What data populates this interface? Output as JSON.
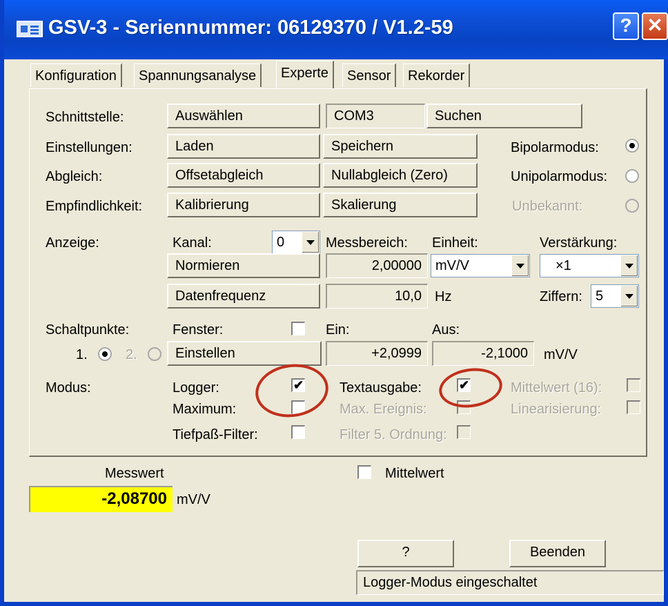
{
  "window": {
    "title": "GSV-3 - Seriennummer: 06129370 / V1.2-59",
    "help_label": "?",
    "close_label": "✕"
  },
  "tabs": [
    {
      "label": "Konfiguration",
      "active": false
    },
    {
      "label": "Spannungsanalyse",
      "active": false
    },
    {
      "label": "Experte",
      "active": true
    },
    {
      "label": "Sensor",
      "active": false
    },
    {
      "label": "Rekorder",
      "active": false
    }
  ],
  "interface": {
    "label": "Schnittstelle:",
    "select_button": "Auswählen",
    "port_value": "COM3",
    "search_button": "Suchen"
  },
  "settings": {
    "label": "Einstellungen:",
    "load_button": "Laden",
    "save_button": "Speichern"
  },
  "adjust": {
    "label": "Abgleich:",
    "offset_button": "Offsetabgleich",
    "zero_button": "Nullabgleich (Zero)"
  },
  "sensitivity": {
    "label": "Empfindlichkeit:",
    "calibrate_button": "Kalibrierung",
    "scale_button": "Skalierung"
  },
  "mode_radios": [
    {
      "label": "Bipolarmodus:",
      "checked": true,
      "disabled": false
    },
    {
      "label": "Unipolarmodus:",
      "checked": false,
      "disabled": false
    },
    {
      "label": "Unbekannt:",
      "checked": false,
      "disabled": true
    }
  ],
  "display": {
    "label": "Anzeige:",
    "channel_label": "Kanal:",
    "channel_value": "0",
    "range_label": "Messbereich:",
    "unit_label": "Einheit:",
    "gain_label": "Verstärkung:",
    "normalize_button": "Normieren",
    "range_value": "2,00000",
    "unit_value": "mV/V",
    "gain_value": "×1",
    "datarate_button": "Datenfrequenz",
    "datarate_value": "10,0",
    "datarate_unit": "Hz",
    "digits_label": "Ziffern:",
    "digits_value": "5"
  },
  "switchpoints": {
    "label": "Schaltpunkte:",
    "radio1_label": "1.",
    "radio2_label": "2.",
    "window_label": "Fenster:",
    "on_label": "Ein:",
    "off_label": "Aus:",
    "set_button": "Einstellen",
    "on_value": "+2,0999",
    "off_value": "-2,1000",
    "unit": "mV/V"
  },
  "modus": {
    "label": "Modus:",
    "logger": {
      "label": "Logger:",
      "checked": true
    },
    "maximum": {
      "label": "Maximum:",
      "checked": false
    },
    "lowpass": {
      "label": "Tiefpaß-Filter:",
      "checked": false
    },
    "textout": {
      "label": "Textausgabe:",
      "checked": true
    },
    "max_event": {
      "label": "Max. Ereignis:",
      "checked": false
    },
    "filter5": {
      "label": "Filter 5. Ordnung:",
      "checked": false
    },
    "average16": {
      "label": "Mittelwert (16):",
      "checked": false
    },
    "linearization": {
      "label": "Linearisierung:",
      "checked": false
    }
  },
  "measurement": {
    "label": "Messwert",
    "value": "-2,08700",
    "unit": "mV/V",
    "average_label": "Mittelwert",
    "average_checked": false
  },
  "footer": {
    "help_button": "?",
    "exit_button": "Beenden",
    "status_text": "Logger-Modus eingeschaltet"
  },
  "colors": {
    "measure_bg": "#ffff00",
    "annotation_circle": "#c0301c",
    "titlebar": "#0a4bd6"
  }
}
